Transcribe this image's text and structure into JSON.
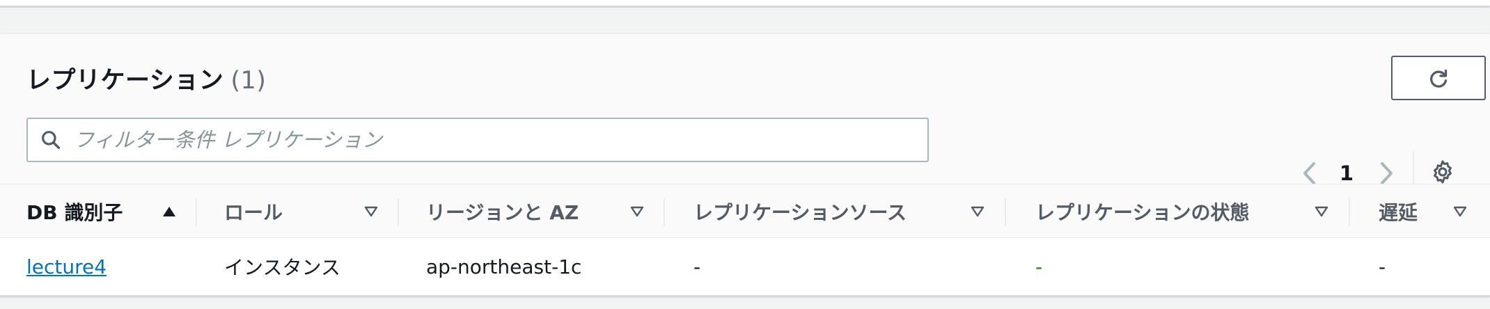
{
  "section": {
    "title": "レプリケーション",
    "count": "(1)"
  },
  "filter": {
    "placeholder": "フィルター条件 レプリケーション",
    "value": ""
  },
  "pagination": {
    "current_page": "1"
  },
  "icons": {
    "refresh": "refresh-icon",
    "search": "search-icon",
    "prev": "chevron-left-icon",
    "next": "chevron-right-icon",
    "settings": "gear-icon",
    "sort_asc": "caret-up-filled-icon",
    "sort_none": "caret-down-outline-icon"
  },
  "table": {
    "columns": [
      {
        "label": "DB 識別子",
        "sort": "ascending"
      },
      {
        "label": "ロール",
        "sort": "none"
      },
      {
        "label": "リージョンと AZ",
        "sort": "none"
      },
      {
        "label": "レプリケーションソース",
        "sort": "none"
      },
      {
        "label": "レプリケーションの状態",
        "sort": "none"
      },
      {
        "label": "遅延",
        "sort": "none"
      }
    ],
    "rows": [
      {
        "db_identifier": "lecture4",
        "role": "インスタンス",
        "region_az": "ap-northeast-1c",
        "replication_source": "-",
        "replication_status": "-",
        "lag": "-"
      }
    ]
  },
  "colors": {
    "link": "#0073bb",
    "status_dash": "#1d8102",
    "header_text": "#545b64",
    "border_dark": "#545b64"
  }
}
